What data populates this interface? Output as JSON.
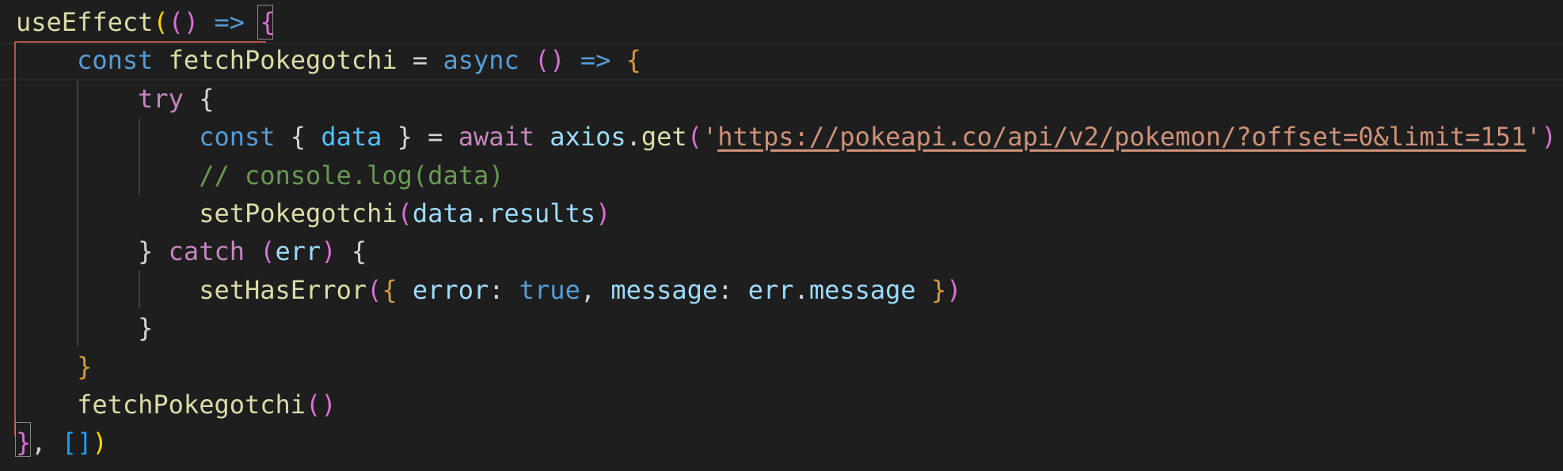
{
  "editor": {
    "theme": "dark",
    "background": "#1e1e1e",
    "lines": [
      {
        "tokens": [
          {
            "text": "useEffect",
            "kind": "fn"
          },
          {
            "text": "(",
            "kind": "b1"
          },
          {
            "text": "()",
            "kind": "b2"
          },
          {
            "text": " ",
            "kind": "p"
          },
          {
            "text": "=>",
            "kind": "arrow"
          },
          {
            "text": " ",
            "kind": "p"
          },
          {
            "text": "{",
            "kind": "b2"
          }
        ]
      },
      {
        "tokens": [
          {
            "text": "    ",
            "kind": "p"
          },
          {
            "text": "const",
            "kind": "kw"
          },
          {
            "text": " ",
            "kind": "p"
          },
          {
            "text": "fetchPokegotchi",
            "kind": "fn"
          },
          {
            "text": " = ",
            "kind": "op"
          },
          {
            "text": "async",
            "kind": "kw"
          },
          {
            "text": " ",
            "kind": "p"
          },
          {
            "text": "()",
            "kind": "b2"
          },
          {
            "text": " ",
            "kind": "p"
          },
          {
            "text": "=>",
            "kind": "arrow"
          },
          {
            "text": " ",
            "kind": "p"
          },
          {
            "text": "{",
            "kind": "b4"
          }
        ]
      },
      {
        "tokens": [
          {
            "text": "        ",
            "kind": "p"
          },
          {
            "text": "try",
            "kind": "ctl"
          },
          {
            "text": " {",
            "kind": "p"
          }
        ]
      },
      {
        "tokens": [
          {
            "text": "            ",
            "kind": "p"
          },
          {
            "text": "const",
            "kind": "kw"
          },
          {
            "text": " { ",
            "kind": "p"
          },
          {
            "text": "data",
            "kind": "const"
          },
          {
            "text": " } = ",
            "kind": "p"
          },
          {
            "text": "await",
            "kind": "ctl"
          },
          {
            "text": " ",
            "kind": "p"
          },
          {
            "text": "axios",
            "kind": "var"
          },
          {
            "text": ".",
            "kind": "p"
          },
          {
            "text": "get",
            "kind": "fn"
          },
          {
            "text": "(",
            "kind": "b2"
          },
          {
            "text": "'",
            "kind": "str"
          },
          {
            "text": "https://pokeapi.co/api/v2/pokemon/?offset=0&limit=151",
            "kind": "url"
          },
          {
            "text": "'",
            "kind": "str"
          },
          {
            "text": ")",
            "kind": "b2"
          }
        ]
      },
      {
        "tokens": [
          {
            "text": "            ",
            "kind": "p"
          },
          {
            "text": "// console.log(data)",
            "kind": "cmt"
          }
        ]
      },
      {
        "tokens": [
          {
            "text": "            ",
            "kind": "p"
          },
          {
            "text": "setPokegotchi",
            "kind": "fn"
          },
          {
            "text": "(",
            "kind": "b2"
          },
          {
            "text": "data",
            "kind": "var"
          },
          {
            "text": ".",
            "kind": "p"
          },
          {
            "text": "results",
            "kind": "var"
          },
          {
            "text": ")",
            "kind": "b2"
          }
        ]
      },
      {
        "tokens": [
          {
            "text": "        ",
            "kind": "p"
          },
          {
            "text": "} ",
            "kind": "p"
          },
          {
            "text": "catch",
            "kind": "ctl"
          },
          {
            "text": " ",
            "kind": "p"
          },
          {
            "text": "(",
            "kind": "b2"
          },
          {
            "text": "err",
            "kind": "var"
          },
          {
            "text": ")",
            "kind": "b2"
          },
          {
            "text": " {",
            "kind": "p"
          }
        ]
      },
      {
        "tokens": [
          {
            "text": "            ",
            "kind": "p"
          },
          {
            "text": "setHasError",
            "kind": "fn"
          },
          {
            "text": "(",
            "kind": "b2"
          },
          {
            "text": "{",
            "kind": "b4"
          },
          {
            "text": " ",
            "kind": "p"
          },
          {
            "text": "error",
            "kind": "var"
          },
          {
            "text": ": ",
            "kind": "p"
          },
          {
            "text": "true",
            "kind": "kw"
          },
          {
            "text": ", ",
            "kind": "p"
          },
          {
            "text": "message",
            "kind": "var"
          },
          {
            "text": ": ",
            "kind": "p"
          },
          {
            "text": "err",
            "kind": "var"
          },
          {
            "text": ".",
            "kind": "p"
          },
          {
            "text": "message",
            "kind": "var"
          },
          {
            "text": " ",
            "kind": "p"
          },
          {
            "text": "}",
            "kind": "b4"
          },
          {
            "text": ")",
            "kind": "b2"
          }
        ]
      },
      {
        "tokens": [
          {
            "text": "        ",
            "kind": "p"
          },
          {
            "text": "}",
            "kind": "p"
          }
        ]
      },
      {
        "tokens": [
          {
            "text": "    ",
            "kind": "p"
          },
          {
            "text": "}",
            "kind": "b4"
          }
        ]
      },
      {
        "tokens": [
          {
            "text": "    ",
            "kind": "p"
          },
          {
            "text": "fetchPokegotchi",
            "kind": "fn"
          },
          {
            "text": "()",
            "kind": "b2"
          }
        ]
      },
      {
        "tokens": [
          {
            "text": "}",
            "kind": "b2"
          },
          {
            "text": ", ",
            "kind": "p"
          },
          {
            "text": "[]",
            "kind": "b3"
          },
          {
            "text": ")",
            "kind": "b1"
          }
        ]
      }
    ]
  }
}
